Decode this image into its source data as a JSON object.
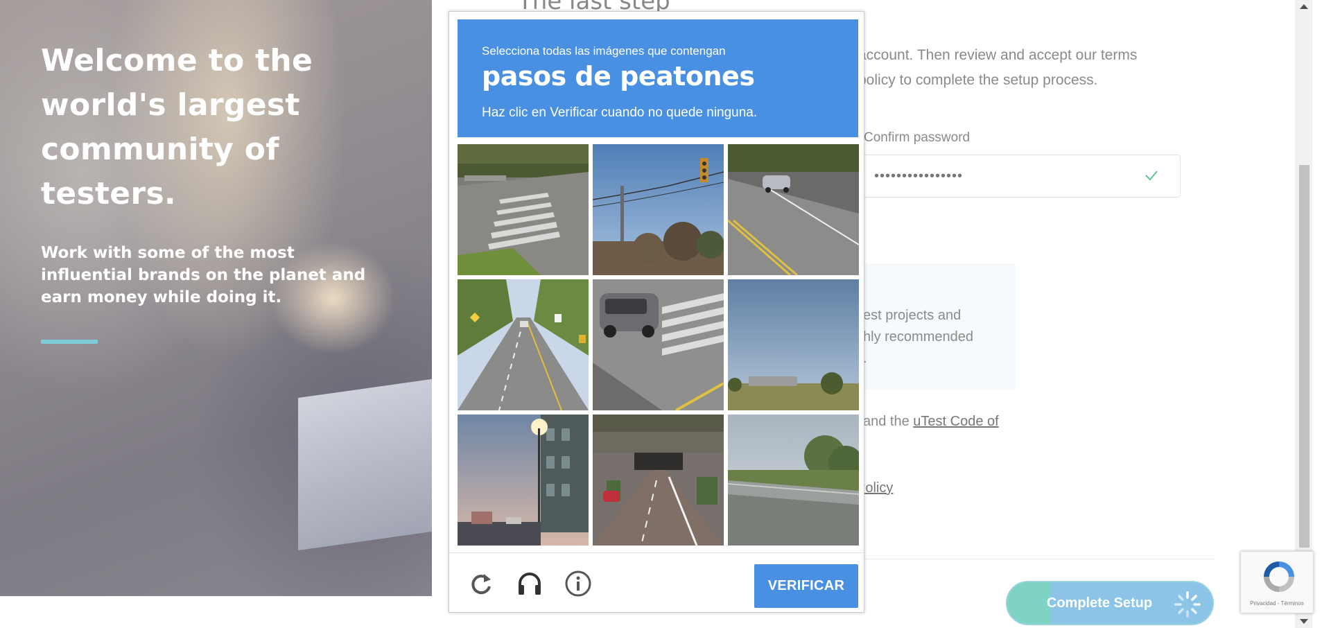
{
  "hero": {
    "headline": "Welcome to the world's largest community of testers.",
    "subtext": "Work with some of the most influential brands on the planet and earn money while doing it."
  },
  "form": {
    "step_title": "The last step",
    "intro_line1": "account. Then review and accept our terms",
    "intro_line2": "policy to complete the setup process.",
    "confirm_password_label": "Confirm password",
    "confirm_password_value": "••••••••••••••••",
    "info_line1": "est projects and",
    "info_line2": "hly recommended",
    "info_line3": ".",
    "terms_prefix": "and the ",
    "terms_link": "uTest Code of",
    "policy_link": "Policy",
    "complete_button": "Complete Setup"
  },
  "captcha": {
    "instruction_line1": "Selecciona todas las imágenes que contengan",
    "target": "pasos de peatones",
    "instruction_line3": "Haz clic en Verificar cuando no quede ninguna.",
    "verify_button": "VERIFICAR",
    "tiles": [
      {
        "scene": "crosswalk-road-trees"
      },
      {
        "scene": "traffic-light-pole-sky"
      },
      {
        "scene": "road-with-car"
      },
      {
        "scene": "tree-lined-street"
      },
      {
        "scene": "car-at-crosswalk"
      },
      {
        "scene": "sky-over-field"
      },
      {
        "scene": "city-street-sunset"
      },
      {
        "scene": "road-under-bridge"
      },
      {
        "scene": "bridge-railing-trees"
      }
    ]
  },
  "recaptcha_badge": {
    "text": "Privacidad - Términos"
  },
  "colors": {
    "captcha_blue": "#4a90e2",
    "accent_teal": "#7dcbd8",
    "check_green": "#5cc48f"
  },
  "icons": [
    "reload-icon",
    "headphones-icon",
    "info-icon",
    "check-icon",
    "spinner-icon",
    "recaptcha-logo-icon"
  ]
}
